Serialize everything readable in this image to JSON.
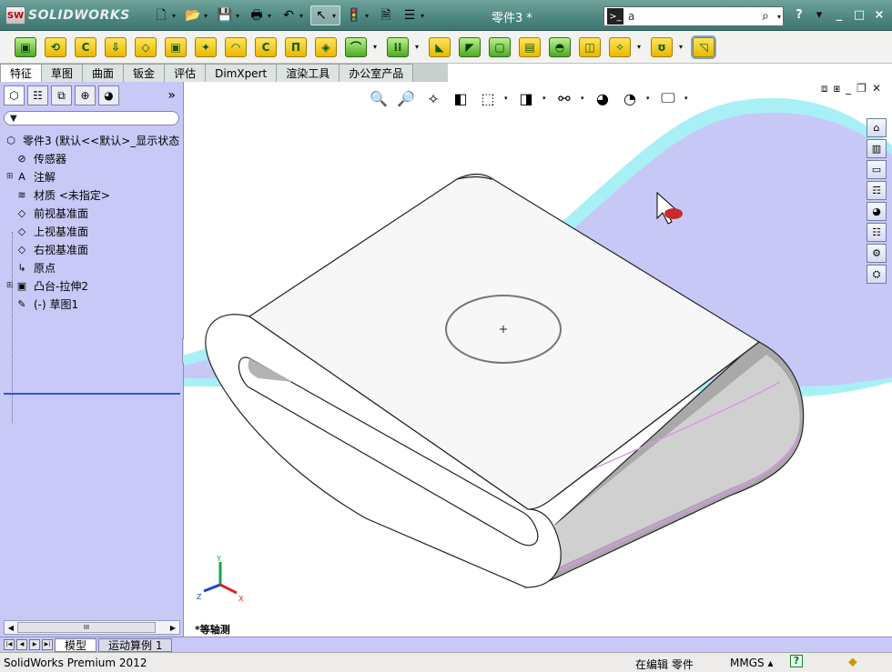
{
  "app": {
    "logo_text": "SOLIDWORKS",
    "logo_mark": "SW",
    "document_title": "零件3 *"
  },
  "quick_access": [
    {
      "name": "new-icon",
      "glyph": "🗋"
    },
    {
      "name": "open-icon",
      "glyph": "📂"
    },
    {
      "name": "save-icon",
      "glyph": "💾"
    },
    {
      "name": "print-icon",
      "glyph": "🖶"
    },
    {
      "name": "undo-icon",
      "glyph": "↶"
    },
    {
      "name": "select-icon",
      "glyph": "↖"
    },
    {
      "name": "rebuild-icon",
      "glyph": "🚦"
    },
    {
      "name": "file-properties-icon",
      "glyph": "🗎"
    },
    {
      "name": "options-icon",
      "glyph": "☰"
    }
  ],
  "search": {
    "value": "a"
  },
  "help_glyph": "?",
  "window_controls": [
    "_",
    "□",
    "×"
  ],
  "commands": [
    {
      "name": "extruded-boss-icon",
      "glyph": "▣",
      "style": "green"
    },
    {
      "name": "revolved-boss-icon",
      "glyph": "⟲",
      "style": ""
    },
    {
      "name": "swept-boss-icon",
      "glyph": "C",
      "style": ""
    },
    {
      "name": "lofted-boss-icon",
      "glyph": "⇩",
      "style": ""
    },
    {
      "name": "boundary-boss-icon",
      "glyph": "◇",
      "style": ""
    },
    {
      "name": "extruded-cut-icon",
      "glyph": "▣",
      "style": ""
    },
    {
      "name": "hole-wizard-icon",
      "glyph": "✦",
      "style": ""
    },
    {
      "name": "revolved-cut-icon",
      "glyph": "◠",
      "style": ""
    },
    {
      "name": "swept-cut-icon",
      "glyph": "C",
      "style": ""
    },
    {
      "name": "lofted-cut-icon",
      "glyph": "Π",
      "style": ""
    },
    {
      "name": "boundary-cut-icon",
      "glyph": "◈",
      "style": ""
    },
    {
      "name": "fillet-icon",
      "glyph": "⌒",
      "style": "green"
    },
    {
      "name": "linear-pattern-icon",
      "glyph": "⁞⁞",
      "style": "green"
    },
    {
      "name": "rib-icon",
      "glyph": "◣",
      "style": ""
    },
    {
      "name": "draft-icon",
      "glyph": "◤",
      "style": "green"
    },
    {
      "name": "shell-icon",
      "glyph": "▢",
      "style": "green"
    },
    {
      "name": "wrap-icon",
      "glyph": "▤",
      "style": ""
    },
    {
      "name": "dome-icon",
      "glyph": "◓",
      "style": "green"
    },
    {
      "name": "mirror-icon",
      "glyph": "◫",
      "style": ""
    },
    {
      "name": "reference-geometry-icon",
      "glyph": "✧",
      "style": ""
    },
    {
      "name": "curves-icon",
      "glyph": "ʊ",
      "style": ""
    },
    {
      "name": "instant3d-icon",
      "glyph": "◹",
      "style": "hi"
    }
  ],
  "tabs": [
    {
      "label": "特征",
      "active": true
    },
    {
      "label": "草图",
      "active": false
    },
    {
      "label": "曲面",
      "active": false
    },
    {
      "label": "钣金",
      "active": false
    },
    {
      "label": "评估",
      "active": false
    },
    {
      "label": "DimXpert",
      "active": false
    },
    {
      "label": "渲染工具",
      "active": false
    },
    {
      "label": "办公室产品",
      "active": false
    }
  ],
  "panel_tools": [
    {
      "name": "feature-manager-icon",
      "glyph": "⬡",
      "selected": true
    },
    {
      "name": "property-manager-icon",
      "glyph": "☷",
      "selected": false
    },
    {
      "name": "configuration-manager-icon",
      "glyph": "⧉",
      "selected": false
    },
    {
      "name": "dimxpert-manager-icon",
      "glyph": "⊕",
      "selected": false
    },
    {
      "name": "display-manager-icon",
      "glyph": "◕",
      "selected": false
    }
  ],
  "panel_more": "»",
  "tree": {
    "root": "零件3  (默认<<默认>_显示状态",
    "items": [
      {
        "label": "传感器",
        "icon": "sensor-icon",
        "glyph": "⊘",
        "expandable": false
      },
      {
        "label": "注解",
        "icon": "annotation-icon",
        "glyph": "A",
        "expandable": true
      },
      {
        "label": "材质 <未指定>",
        "icon": "material-icon",
        "glyph": "≋",
        "expandable": false
      },
      {
        "label": "前视基准面",
        "icon": "plane-icon",
        "glyph": "◇",
        "expandable": false
      },
      {
        "label": "上视基准面",
        "icon": "plane-icon",
        "glyph": "◇",
        "expandable": false
      },
      {
        "label": "右视基准面",
        "icon": "plane-icon",
        "glyph": "◇",
        "expandable": false
      },
      {
        "label": "原点",
        "icon": "origin-icon",
        "glyph": "↳",
        "expandable": false
      },
      {
        "label": "凸台-拉伸2",
        "icon": "boss-extrude-icon",
        "glyph": "▣",
        "expandable": true
      },
      {
        "label": "(-) 草图1",
        "icon": "sketch-icon",
        "glyph": "✎",
        "expandable": false
      }
    ]
  },
  "scroll_thumb": "III",
  "hud": [
    {
      "name": "zoom-to-fit-icon",
      "glyph": "🔍",
      "dd": false
    },
    {
      "name": "zoom-to-area-icon",
      "glyph": "🔎",
      "dd": false
    },
    {
      "name": "previous-view-icon",
      "glyph": "⟡",
      "dd": false
    },
    {
      "name": "section-view-icon",
      "glyph": "◧",
      "dd": false
    },
    {
      "name": "view-orientation-icon",
      "glyph": "⬚",
      "dd": true
    },
    {
      "name": "display-style-icon",
      "glyph": "◨",
      "dd": true
    },
    {
      "name": "hide-show-items-icon",
      "glyph": "⚯",
      "dd": true
    },
    {
      "name": "edit-appearance-icon",
      "glyph": "◕",
      "dd": false
    },
    {
      "name": "apply-scene-icon",
      "glyph": "◔",
      "dd": true
    },
    {
      "name": "view-settings-icon",
      "glyph": "🖵",
      "dd": true
    }
  ],
  "viewport_controls": [
    "⧈",
    "⧆",
    "_",
    "❐",
    "✕"
  ],
  "task_pane": [
    {
      "name": "home-icon",
      "glyph": "⌂"
    },
    {
      "name": "design-library-icon",
      "glyph": "▥"
    },
    {
      "name": "file-explorer-icon",
      "glyph": "▭"
    },
    {
      "name": "view-palette-icon",
      "glyph": "☶"
    },
    {
      "name": "appearances-icon",
      "glyph": "◕"
    },
    {
      "name": "custom-properties-icon",
      "glyph": "☷"
    },
    {
      "name": "tolerance-icon",
      "glyph": "⚙"
    },
    {
      "name": "solidworks-resources-icon",
      "glyph": "⛭"
    }
  ],
  "triad": {
    "x": "X",
    "y": "Y",
    "z": "Z"
  },
  "view_label": "*等轴测",
  "bottom_tabs": [
    {
      "label": "模型",
      "active": true
    },
    {
      "label": "运动算例 1",
      "active": false
    }
  ],
  "status": {
    "app_name": "SolidWorks Premium 2012",
    "mode": "在编辑 零件",
    "units": "MMGS ▴",
    "help": "?"
  },
  "colors": {
    "titlebar": "#4d8680",
    "panel": "#c9c9f7",
    "background_blob": "#c8c8f7",
    "background_edge": "#a8f0f6",
    "accent_pink": "#d996e6"
  }
}
